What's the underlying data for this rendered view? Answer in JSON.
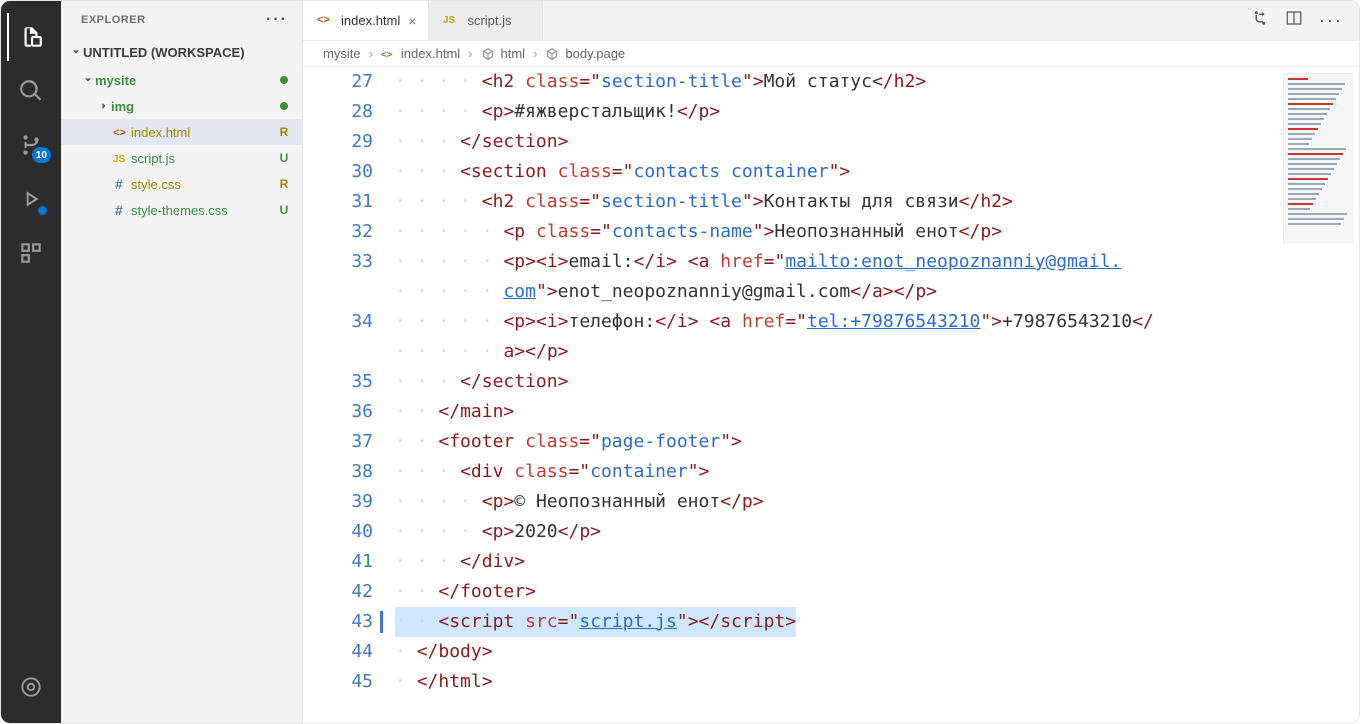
{
  "activity": {
    "scm_badge": "10"
  },
  "sidebar": {
    "title": "EXPLORER",
    "root": "UNTITLED (WORKSPACE)",
    "items": [
      {
        "label": "mysite",
        "kind": "folder",
        "status_dot": true
      },
      {
        "label": "img",
        "kind": "folder",
        "status_dot": true
      },
      {
        "label": "index.html",
        "kind": "file",
        "icon": "html",
        "status": "R",
        "status_k": "olive",
        "color": "olive",
        "sel": true
      },
      {
        "label": "script.js",
        "kind": "file",
        "icon": "js",
        "status": "U",
        "status_k": "green",
        "color": "green"
      },
      {
        "label": "style.css",
        "kind": "file",
        "icon": "hash",
        "status": "R",
        "status_k": "olive",
        "color": "olive"
      },
      {
        "label": "style-themes.css",
        "kind": "file",
        "icon": "hash",
        "status": "U",
        "status_k": "green",
        "color": "green"
      }
    ]
  },
  "tabs": [
    {
      "icon": "html",
      "label": "index.html",
      "active": true,
      "closeable": true
    },
    {
      "icon": "js",
      "label": "script.js",
      "active": false,
      "closeable": false
    }
  ],
  "breadcrumbs": [
    {
      "label": "mysite"
    },
    {
      "icon": "html",
      "label": "index.html"
    },
    {
      "icon": "cube",
      "label": "html"
    },
    {
      "icon": "cube",
      "label": "body.page"
    }
  ],
  "code": {
    "first_line": 27,
    "modified_line": 43,
    "lines": {
      "27": {
        "indent": 4,
        "tag_open": "h2",
        "attr": "class",
        "val": "section-title",
        "text": "Мой статус",
        "tag_close": "h2"
      },
      "28": {
        "indent": 4,
        "tag_open": "p",
        "text": "#яжверстальщик!",
        "tag_close": "p"
      },
      "29": {
        "indent": 3,
        "close": "section"
      },
      "30": {
        "indent": 3,
        "tag_open": "section",
        "attr": "class",
        "val": "contacts container"
      },
      "31": {
        "indent": 4,
        "tag_open": "h2",
        "attr": "class",
        "val": "section-title",
        "text": "Контакты для связи",
        "tag_close": "h2"
      },
      "32": {
        "indent": 5,
        "tag_open": "p",
        "attr": "class",
        "val": "contacts-name",
        "text": "Неопознанный енот",
        "tag_close": "p"
      },
      "33": {
        "indent": 5,
        "p_i": "email:",
        "a_href": "mailto:enot_neopoznanniy@gmail.com",
        "a_text": "enot_neopoznanniy@gmail.com",
        "wrap": true,
        "wrap_href_tail": "com"
      },
      "34": {
        "indent": 5,
        "p_i": "телефон:",
        "a_href": "tel:+79876543210",
        "a_text": "+79876543210",
        "wrap_close": true
      },
      "35": {
        "indent": 3,
        "close": "section"
      },
      "36": {
        "indent": 2,
        "close": "main"
      },
      "37": {
        "indent": 2,
        "tag_open": "footer",
        "attr": "class",
        "val": "page-footer"
      },
      "38": {
        "indent": 3,
        "tag_open": "div",
        "attr": "class",
        "val": "container"
      },
      "39": {
        "indent": 4,
        "tag_open": "p",
        "text": "© Неопознанный енот",
        "tag_close": "p"
      },
      "40": {
        "indent": 4,
        "tag_open": "p",
        "text": "2020",
        "tag_close": "p"
      },
      "41": {
        "indent": 3,
        "close": "div"
      },
      "42": {
        "indent": 2,
        "close": "footer"
      },
      "43": {
        "indent": 2,
        "script_src": "script.js",
        "hot": true
      },
      "44": {
        "indent": 1,
        "close": "body"
      },
      "45": {
        "indent": 1,
        "close": "html"
      }
    }
  }
}
